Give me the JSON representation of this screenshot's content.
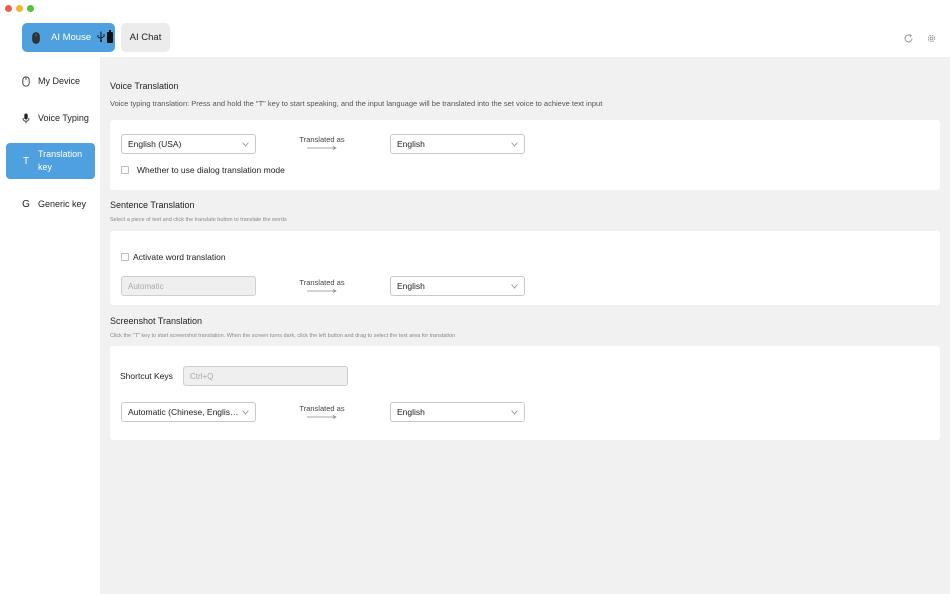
{
  "header": {
    "tabs": [
      {
        "label": "AI Mouse",
        "active": true
      },
      {
        "label": "AI Chat",
        "active": false
      }
    ],
    "icons": [
      "refresh-icon",
      "gear-icon"
    ]
  },
  "sidebar": {
    "items": [
      {
        "label": "My Device",
        "icon": "mouse-icon",
        "active": false
      },
      {
        "label": "Voice Typing",
        "icon": "microphone-icon",
        "active": false
      },
      {
        "label": "Translation key",
        "icon": "T",
        "active": true
      },
      {
        "label": "Generic key",
        "icon": "G",
        "active": false
      }
    ]
  },
  "voice": {
    "title": "Voice Translation",
    "description": "Voice typing translation: Press and hold the \"T\" key to start speaking, and the input language will be translated into the set voice to achieve text input",
    "source_lang": "English (USA)",
    "translated_as": "Translated as",
    "target_lang": "English",
    "dialog_mode_label": "Whether to use dialog translation mode",
    "dialog_mode_checked": false
  },
  "sentence": {
    "title": "Sentence Translation",
    "description": "Select a piece of text and click the translate button to translate the words",
    "activate_label": "Activate word translation",
    "activate_checked": false,
    "source_placeholder": "Automatic",
    "translated_as": "Translated as",
    "target_lang": "English"
  },
  "screenshot": {
    "title": "Screenshot Translation",
    "description": "Click the \"T\" key to start screenshot translation. When the screen turns dark, click the left button and drag to select the text area for translation",
    "shortcut_label": "Shortcut Keys",
    "shortcut_value": "Ctrl+Q",
    "source_lang": "Automatic (Chinese, English, ...)",
    "translated_as": "Translated as",
    "target_lang": "English"
  },
  "colors": {
    "accent": "#4fa0df",
    "main_bg": "#f1f1f1",
    "card_bg": "#ffffff"
  }
}
